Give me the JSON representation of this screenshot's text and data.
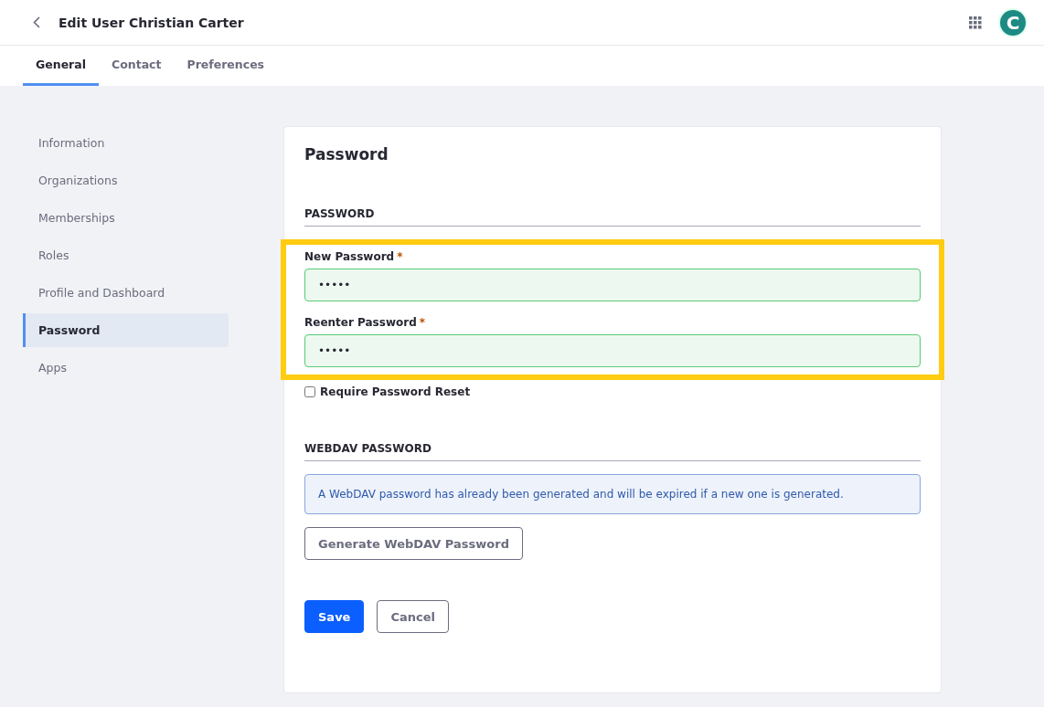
{
  "header": {
    "title": "Edit User Christian Carter",
    "avatar_letter": "C"
  },
  "tabs": [
    {
      "label": "General",
      "selected": true
    },
    {
      "label": "Contact",
      "selected": false
    },
    {
      "label": "Preferences",
      "selected": false
    }
  ],
  "sidebar": {
    "items": [
      {
        "label": "Information",
        "selected": false
      },
      {
        "label": "Organizations",
        "selected": false
      },
      {
        "label": "Memberships",
        "selected": false
      },
      {
        "label": "Roles",
        "selected": false
      },
      {
        "label": "Profile and Dashboard",
        "selected": false
      },
      {
        "label": "Password",
        "selected": true
      },
      {
        "label": "Apps",
        "selected": false
      }
    ]
  },
  "card": {
    "title": "Password",
    "password_section": {
      "heading": "PASSWORD",
      "highlighted": true,
      "fields": [
        {
          "label": "New Password",
          "required_mark": "*",
          "value": "•••••",
          "valid": true
        },
        {
          "label": "Reenter Password",
          "required_mark": "*",
          "value": "•••••",
          "valid": true
        }
      ],
      "checkbox": {
        "label": "Require Password Reset",
        "checked": false
      }
    },
    "webdav_section": {
      "heading": "WEBDAV PASSWORD",
      "alert": "A WebDAV password has already been generated and will be expired if a new one is generated.",
      "button": "Generate WebDAV Password"
    },
    "buttons": [
      {
        "label": "Save",
        "kind": "primary"
      },
      {
        "label": "Cancel",
        "kind": "secondary"
      }
    ]
  }
}
